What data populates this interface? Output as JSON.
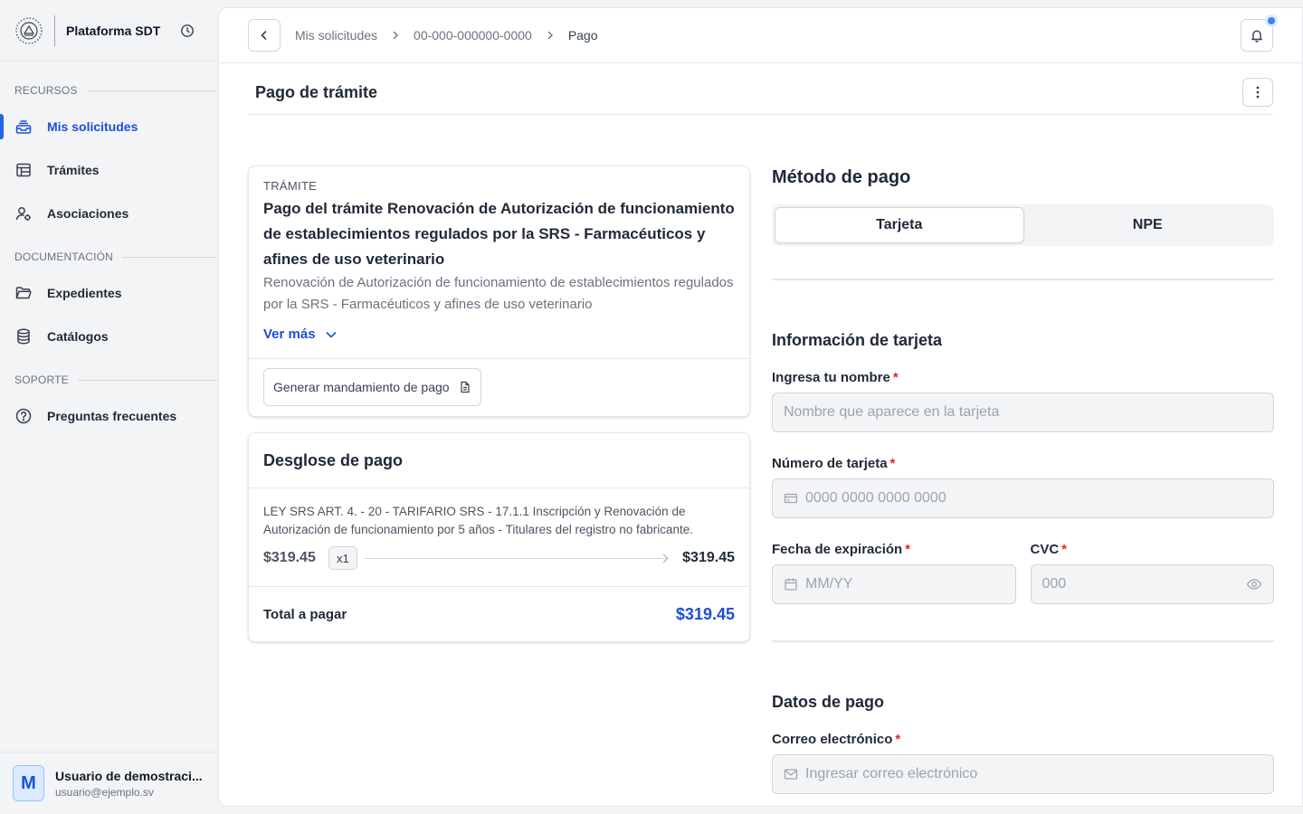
{
  "brand": {
    "title": "Plataforma SDT"
  },
  "sidebar": {
    "sections": [
      {
        "label": "RECURSOS",
        "items": [
          {
            "label": "Mis solicitudes",
            "icon": "inbox-stack-icon",
            "active": true
          },
          {
            "label": "Trámites",
            "icon": "table-icon"
          },
          {
            "label": "Asociaciones",
            "icon": "user-settings-icon"
          }
        ]
      },
      {
        "label": "DOCUMENTACIÓN",
        "items": [
          {
            "label": "Expedientes",
            "icon": "folder-open-icon"
          },
          {
            "label": "Catálogos",
            "icon": "database-icon"
          }
        ]
      },
      {
        "label": "SOPORTE",
        "items": [
          {
            "label": "Preguntas frecuentes",
            "icon": "question-circle-icon"
          }
        ]
      }
    ]
  },
  "user": {
    "initial": "M",
    "name": "Usuario de demostraci...",
    "email": "usuario@ejemplo.sv"
  },
  "breadcrumb": [
    "Mis solicitudes",
    "00-000-000000-0000",
    "Pago"
  ],
  "page": {
    "title": "Pago de trámite"
  },
  "tramite": {
    "label": "TRÁMITE",
    "title": "Pago del trámite Renovación de Autorización de funcionamiento de establecimientos regulados por la SRS - Farmacéuticos y afines de uso veterinario",
    "description": "Renovación de Autorización de funcionamiento de establecimientos regulados por la SRS - Farmacéuticos y afines de uso veterinario",
    "ver_mas": "Ver más",
    "generate_button": "Generar mandamiento de pago"
  },
  "desglose": {
    "title": "Desglose de pago",
    "line": {
      "description": "LEY SRS ART. 4. - 20 - TARIFARIO SRS - 17.1.1 Inscripción y Renovación de Autorización de funcionamiento por 5 años - Titulares del registro no fabricante.",
      "unit_price": "$319.45",
      "quantity": "x1",
      "subtotal": "$319.45"
    },
    "total_label": "Total a pagar",
    "total_value": "$319.45"
  },
  "payment": {
    "title": "Método de pago",
    "methods": [
      "Tarjeta",
      "NPE"
    ],
    "selected": "Tarjeta",
    "card_info_title": "Información de tarjeta",
    "name_label": "Ingresa tu nombre",
    "name_placeholder": "Nombre que aparece en la tarjeta",
    "number_label": "Número de tarjeta",
    "number_placeholder": "0000 0000 0000 0000",
    "expiry_label": "Fecha de expiración",
    "expiry_placeholder": "MM/YY",
    "cvc_label": "CVC",
    "cvc_placeholder": "000",
    "data_title": "Datos de pago",
    "email_label": "Correo electrónico",
    "email_placeholder": "Ingresar correo electrónico",
    "required_mark": "*"
  },
  "colors": {
    "accent": "#1d4ed8",
    "required": "#dc2626",
    "notification_dot": "#3b82f6"
  }
}
